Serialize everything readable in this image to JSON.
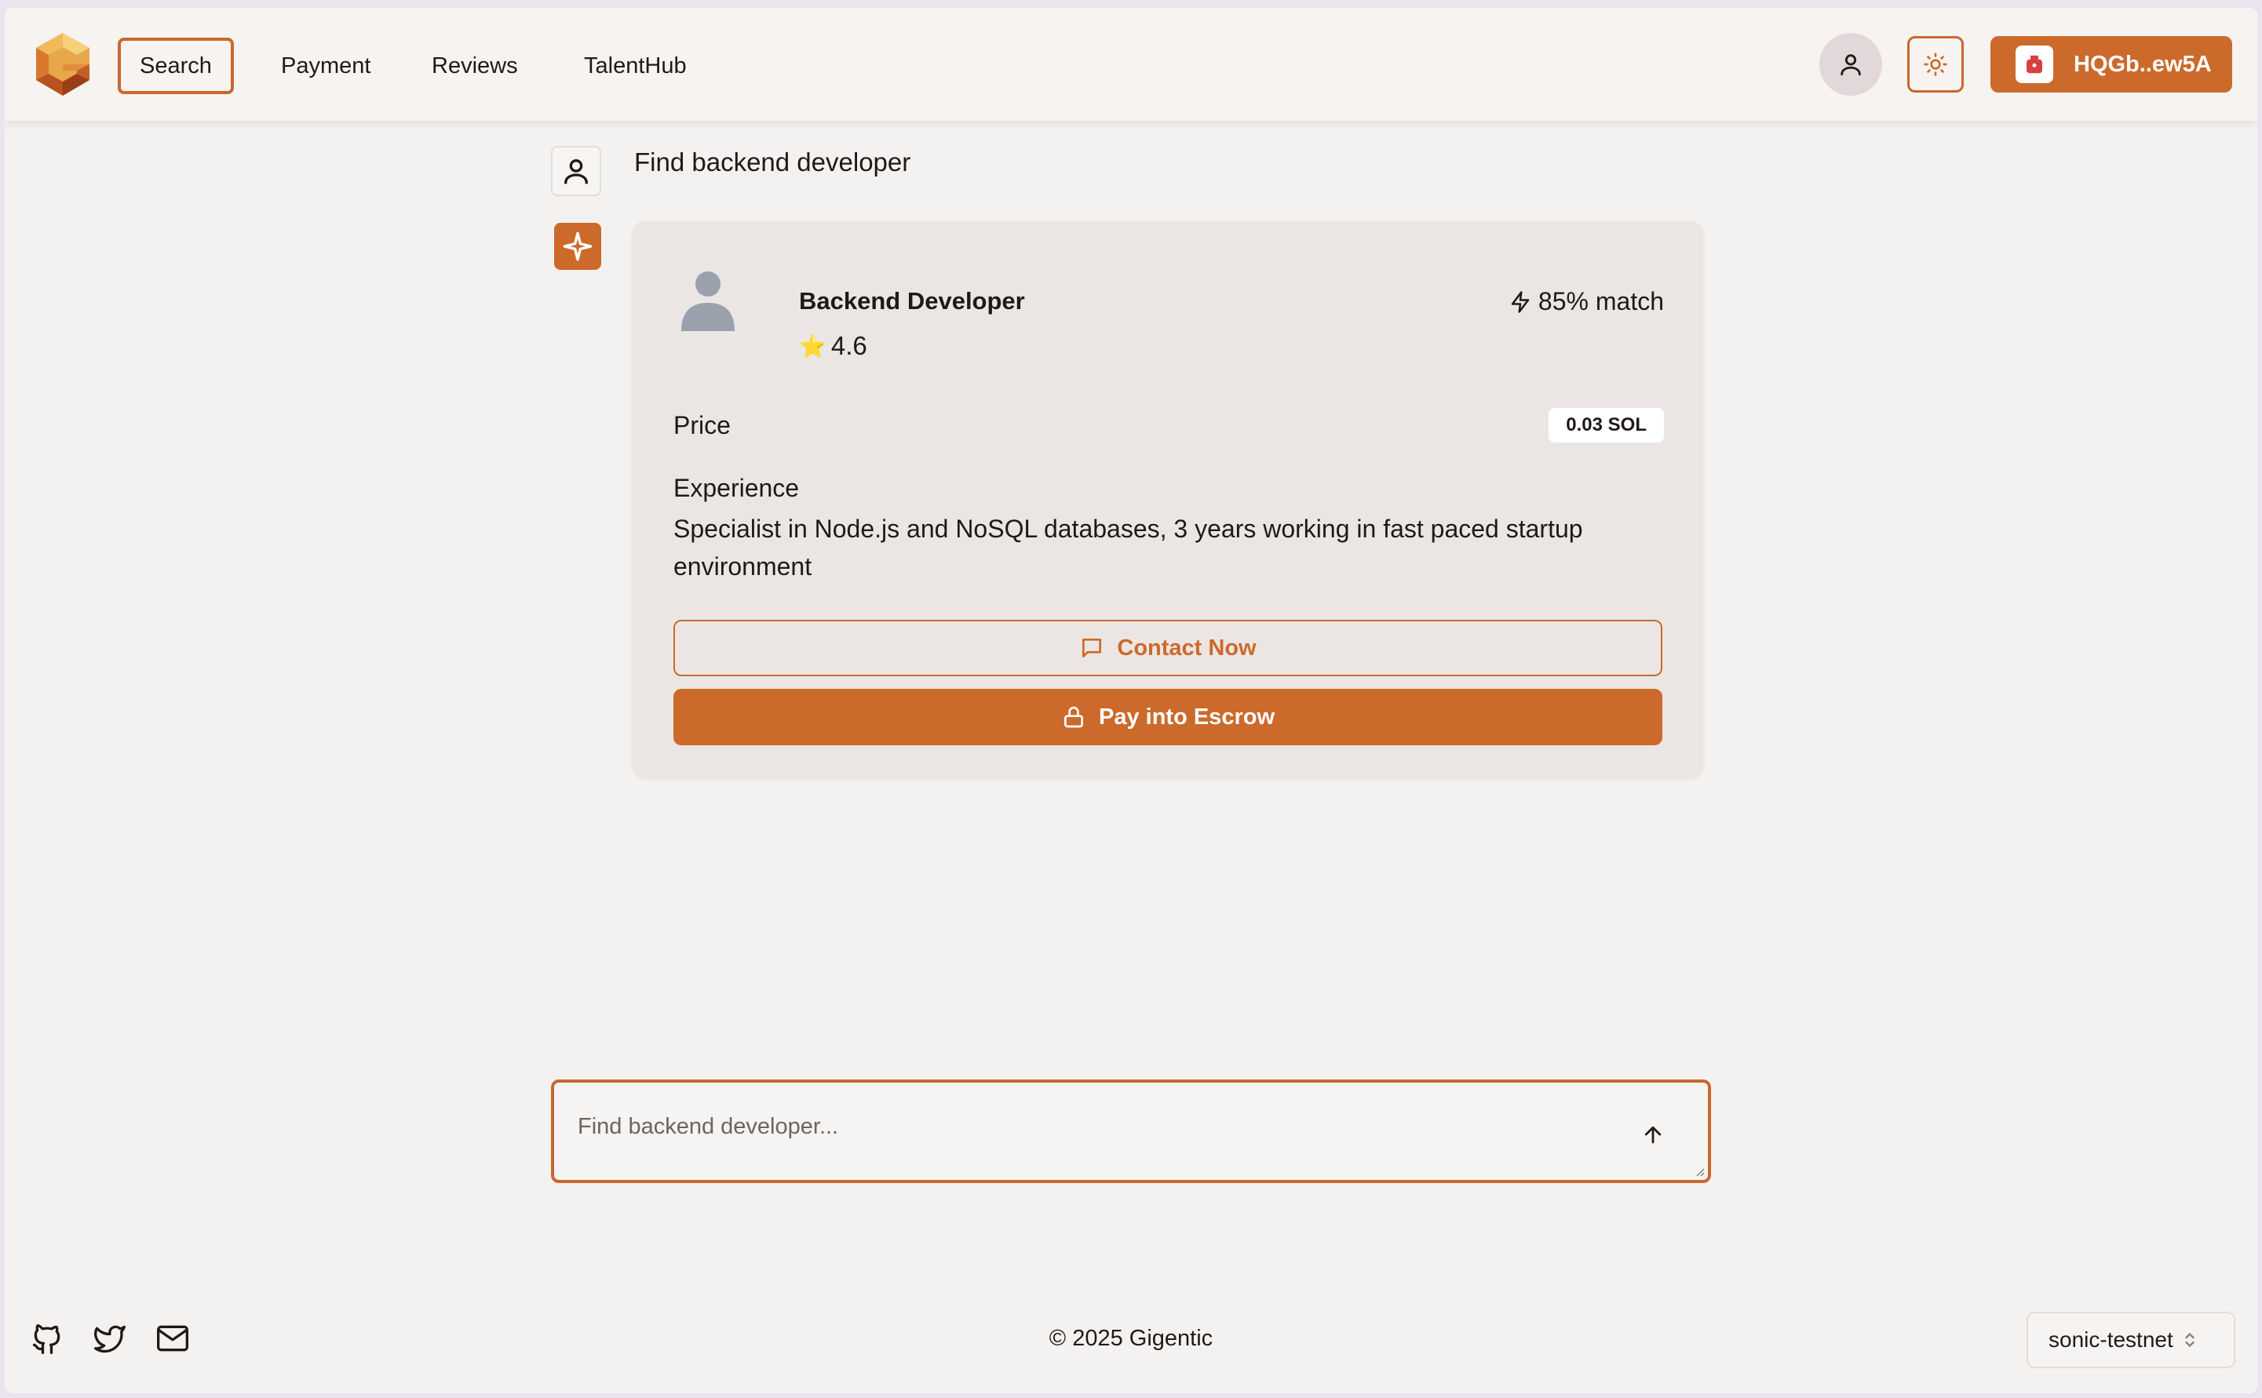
{
  "header": {
    "nav": [
      {
        "label": "Search",
        "active": true
      },
      {
        "label": "Payment",
        "active": false
      },
      {
        "label": "Reviews",
        "active": false
      },
      {
        "label": "TalentHub",
        "active": false
      }
    ],
    "wallet_label": "HQGb..ew5A"
  },
  "chat": {
    "user_message": "Find backend developer",
    "result": {
      "title": "Backend Developer",
      "rating_star": "⭐",
      "rating": "4.6",
      "match": "85% match",
      "price_label": "Price",
      "price_value": "0.03 SOL",
      "experience_label": "Experience",
      "experience_text": "Specialist in Node.js and NoSQL databases, 3 years working in fast paced startup environment",
      "contact_label": "Contact Now",
      "escrow_label": "Pay into Escrow"
    }
  },
  "input": {
    "placeholder": "Find backend developer..."
  },
  "footer": {
    "copyright": "© 2025 Gigentic",
    "network": "sonic-testnet"
  },
  "colors": {
    "accent": "#cc6a2b",
    "background": "#f4f2f0"
  }
}
